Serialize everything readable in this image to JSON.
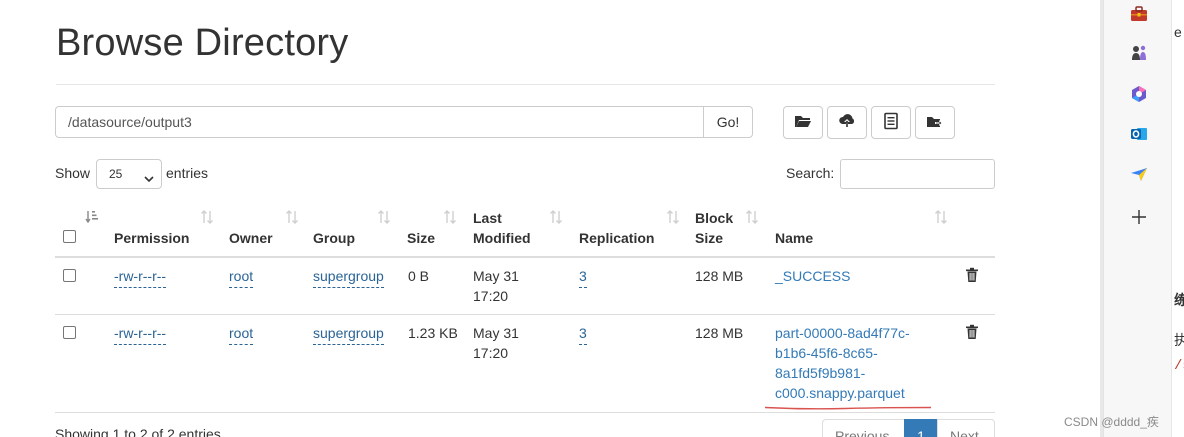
{
  "page": {
    "title": "Browse Directory"
  },
  "path_bar": {
    "value": "/datasource/output3",
    "go_label": "Go!"
  },
  "toolbar": {
    "buttons": [
      {
        "icon": "folder-open-icon"
      },
      {
        "icon": "cloud-upload-icon"
      },
      {
        "icon": "list-alt-icon"
      },
      {
        "icon": "folder-move-icon"
      }
    ]
  },
  "length_control": {
    "show_label": "Show",
    "selected": "25",
    "entries_label": "entries"
  },
  "search": {
    "label": "Search:",
    "value": ""
  },
  "table": {
    "headers": {
      "permission": "Permission",
      "owner": "Owner",
      "group": "Group",
      "size": "Size",
      "last_modified_1": "Last",
      "last_modified_2": "Modified",
      "replication": "Replication",
      "block_size_1": "Block",
      "block_size_2": "Size",
      "name": "Name"
    },
    "rows": [
      {
        "permission": "-rw-r--r--",
        "owner": "root",
        "group": "supergroup",
        "size": "0 B",
        "modified_date": "May 31",
        "modified_time": "17:20",
        "replication": "3",
        "block_size": "128 MB",
        "name": "_SUCCESS"
      },
      {
        "permission": "-rw-r--r--",
        "owner": "root",
        "group": "supergroup",
        "size": "1.23 KB",
        "modified_date": "May 31",
        "modified_time": "17:20",
        "replication": "3",
        "block_size": "128 MB",
        "name_lines": [
          "part-00000-8ad4f77c-",
          "b1b6-45f6-8c65-",
          "8a1fd5f9b981-",
          "c000.snappy.parquet"
        ]
      }
    ]
  },
  "footer": {
    "info": "Showing 1 to 2 of 2 entries",
    "previous": "Previous",
    "current_page": "1",
    "next": "Next"
  },
  "browser_sidebar": {
    "icons": [
      "toolbox-icon",
      "chess-pieces-icon",
      "copilot-icon",
      "outlook-icon",
      "send-arrow-icon",
      "plus-icon"
    ]
  },
  "peek": {
    "line1": "e",
    "line2": "练",
    "line3": "执",
    "line4": "/s"
  },
  "watermark": "CSDN @dddd_疾",
  "colors": {
    "link": "#337ab7",
    "active_page": "#337ab7",
    "annotation_red": "#d9534f"
  }
}
